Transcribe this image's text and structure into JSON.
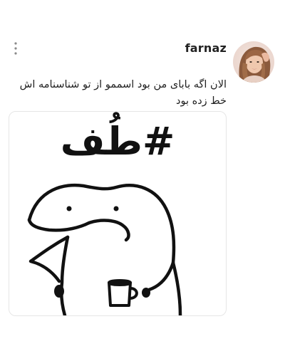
{
  "post": {
    "username": "farnaz",
    "caption": "الان اگه بابای من بود اسممو از تو شناسنامه اش خط زده بود",
    "media": {
      "meme_text": "#طُف"
    }
  },
  "icons": {
    "more": "more-vertical-icon",
    "avatar": "profile-avatar"
  }
}
